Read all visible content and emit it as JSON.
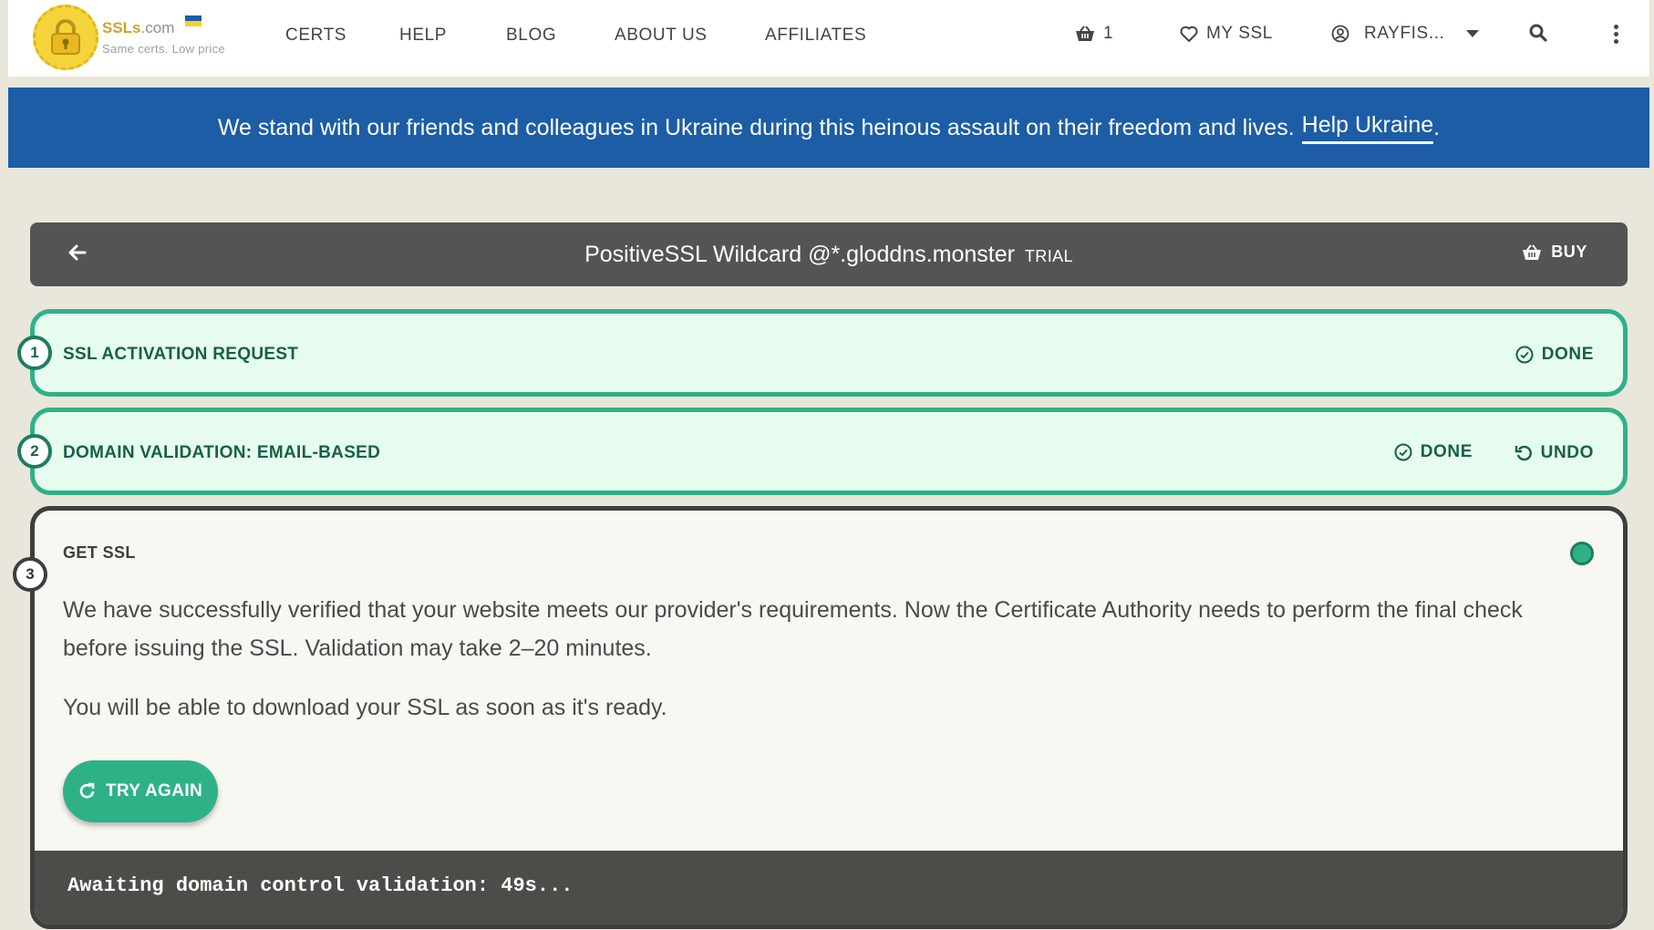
{
  "brand": {
    "name": "SSLs",
    "domain_suffix": ".com",
    "tagline": "Same certs. Low price"
  },
  "nav": {
    "links": [
      "CERTS",
      "HELP",
      "BLOG",
      "ABOUT US",
      "AFFILIATES"
    ],
    "cart_count": "1",
    "my_ssl": "MY SSL",
    "account": "RAYFIS..."
  },
  "banner": {
    "text": "We stand with our friends and colleagues in Ukraine during this heinous assault on their freedom and lives.",
    "link": "Help Ukraine",
    "trailing": ".",
    "color": "#1c5da6"
  },
  "titlebar": {
    "product": "PositiveSSL Wildcard @*.gloddns.monster",
    "badge": "TRIAL",
    "buy": "BUY"
  },
  "steps": [
    {
      "number": "1",
      "title": "SSL ACTIVATION REQUEST",
      "status": "DONE"
    },
    {
      "number": "2",
      "title": "DOMAIN VALIDATION: EMAIL-BASED",
      "status": "DONE",
      "undo": "UNDO"
    },
    {
      "number": "3",
      "title": "GET SSL",
      "paragraph_1": "We have successfully verified that your website meets our provider's requirements. Now the Certificate Authority needs to perform the final check before issuing the SSL. Validation may take 2–20 minutes.",
      "paragraph_2": "You will be able to download your SSL as soon as it's ready.",
      "retry": "TRY AGAIN",
      "console": "Awaiting domain control validation: 49s..."
    }
  ],
  "colors": {
    "accent": "#2fb187",
    "step_bg": "#e6fcee",
    "page_bg": "#e9e6dc",
    "titlebar": "#545454"
  }
}
